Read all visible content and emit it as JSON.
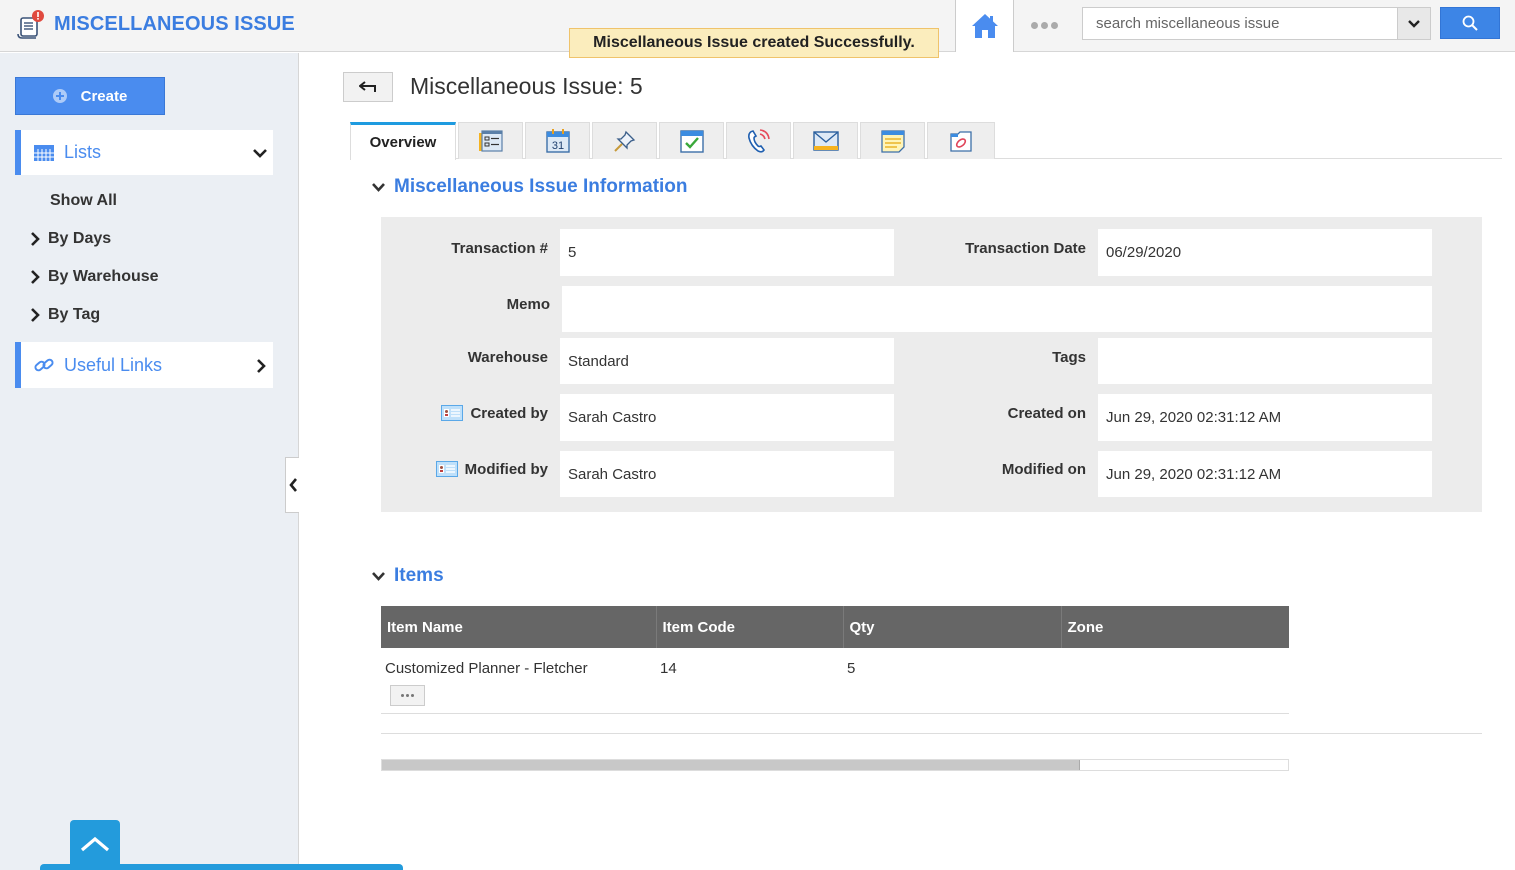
{
  "header": {
    "app_title": "MISCELLANEOUS ISSUE",
    "toast": "Miscellaneous Issue created Successfully.",
    "search_placeholder": "search miscellaneous issue",
    "icons": [
      "document-alert-icon",
      "home-icon",
      "more-dots-icon",
      "chevron-down-icon",
      "search-icon"
    ]
  },
  "sidebar": {
    "create_label": "Create",
    "lists_label": "Lists",
    "list_items": [
      {
        "label": "Show All",
        "expandable": false
      },
      {
        "label": "By Days",
        "expandable": true
      },
      {
        "label": "By Warehouse",
        "expandable": true
      },
      {
        "label": "By Tag",
        "expandable": true
      }
    ],
    "useful_links_label": "Useful Links"
  },
  "page": {
    "title": "Miscellaneous Issue: 5",
    "tabs": [
      {
        "label": "Overview",
        "icon": null,
        "active": true
      },
      {
        "label": "",
        "icon": "details-list-icon"
      },
      {
        "label": "",
        "icon": "calendar-icon",
        "icon_text": "31"
      },
      {
        "label": "",
        "icon": "pushpin-icon"
      },
      {
        "label": "",
        "icon": "task-check-icon"
      },
      {
        "label": "",
        "icon": "phone-call-icon"
      },
      {
        "label": "",
        "icon": "email-icon"
      },
      {
        "label": "",
        "icon": "note-icon"
      },
      {
        "label": "",
        "icon": "attachment-icon"
      }
    ]
  },
  "info": {
    "section_title": "Miscellaneous Issue Information",
    "transaction_no_label": "Transaction #",
    "transaction_no": "5",
    "transaction_date_label": "Transaction Date",
    "transaction_date": "06/29/2020",
    "memo_label": "Memo",
    "memo": "",
    "warehouse_label": "Warehouse",
    "warehouse": "Standard",
    "tags_label": "Tags",
    "tags": "",
    "created_by_label": "Created by",
    "created_by": "Sarah Castro",
    "created_on_label": "Created on",
    "created_on": "Jun 29, 2020 02:31:12 AM",
    "modified_by_label": "Modified by",
    "modified_by": "Sarah Castro",
    "modified_on_label": "Modified on",
    "modified_on": "Jun 29, 2020 02:31:12 AM"
  },
  "items": {
    "section_title": "Items",
    "columns": [
      "Item Name",
      "Item Code",
      "Qty",
      "Zone"
    ],
    "rows": [
      {
        "item_name": "Customized Planner - Fletcher",
        "item_code": "14",
        "qty": "5",
        "zone": ""
      }
    ],
    "scroll_position_fraction": 0.77
  },
  "colors": {
    "brand": "#3b7de0",
    "accent_button": "#4a8cef",
    "toast_bg": "#fbedbd",
    "table_header": "#666666",
    "active_tab_border": "#1e9be0"
  }
}
